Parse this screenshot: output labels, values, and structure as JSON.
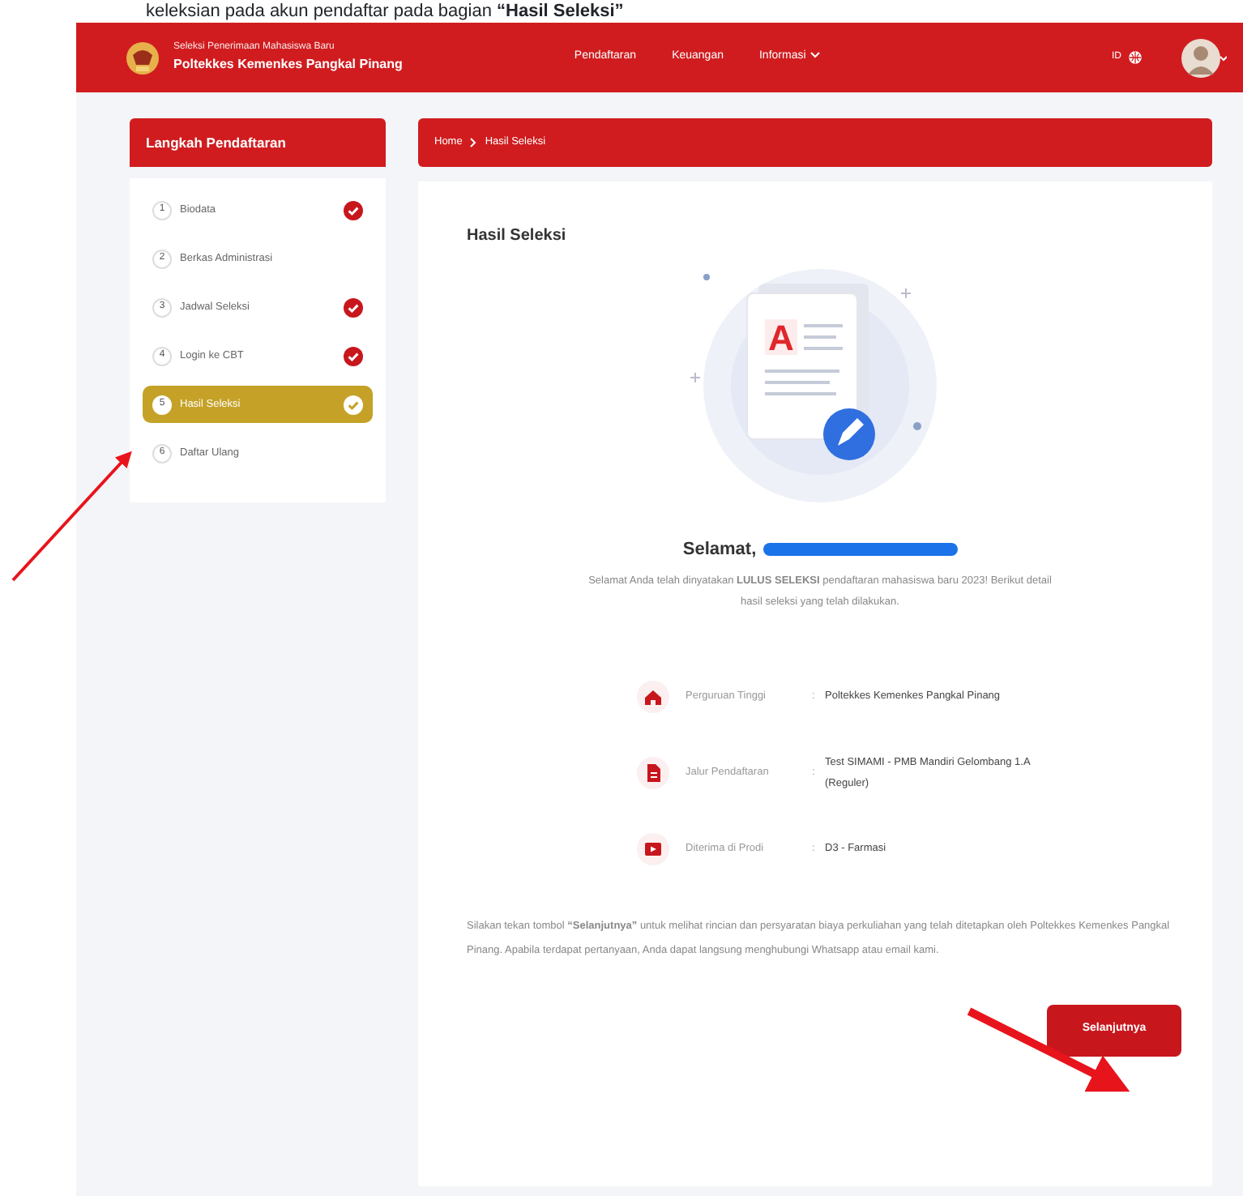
{
  "doc_text": "keleksian pada akun pendaftar pada bagian **“Hasil Seleksi”**",
  "navbar": {
    "subtitle": "Seleksi Penerimaan Mahasiswa Baru",
    "title": "Poltekkes Kemenkes Pangkal Pinang",
    "menu": [
      {
        "label": "Pendaftaran",
        "dropdown": false
      },
      {
        "label": "Keuangan",
        "dropdown": false
      },
      {
        "label": "Informasi",
        "dropdown": true
      }
    ],
    "language": "ID"
  },
  "sidebar": {
    "title": "Langkah Pendaftaran",
    "steps": [
      {
        "number": "1",
        "label": "Biodata",
        "done": true,
        "selected": false
      },
      {
        "number": "2",
        "label": "Berkas Administrasi",
        "done": false,
        "selected": false
      },
      {
        "number": "3",
        "label": "Jadwal Seleksi",
        "done": true,
        "selected": false
      },
      {
        "number": "4",
        "label": "Login ke CBT",
        "done": true,
        "selected": false
      },
      {
        "number": "5",
        "label": "Hasil Seleksi",
        "done": true,
        "selected": true
      },
      {
        "number": "6",
        "label": "Daftar Ulang",
        "done": false,
        "selected": false
      }
    ]
  },
  "breadcrumb": [
    "Home",
    "Hasil Seleksi"
  ],
  "result": {
    "title": "Hasil Seleksi",
    "illustration_letter": "A",
    "greeting": "Selamat,",
    "message": "Selamat Anda telah dinyatakan **LULUS SELEKSI** pendaftaran mahasiswa baru 2023! Berikut detail hasil seleksi yang telah dilakukan.",
    "details": [
      {
        "kind": "campus",
        "label": "Perguruan Tinggi",
        "separator": ":",
        "value": "Poltekkes Kemenkes Pangkal Pinang"
      },
      {
        "kind": "route",
        "label": "Jalur Pendaftaran",
        "separator": ":",
        "value": "Test SIMAMI - PMB Mandiri Gelombang 1.A (Reguler)"
      },
      {
        "kind": "program",
        "label": "Diterima di Prodi",
        "separator": ":",
        "value": "D3 - Farmasi"
      }
    ],
    "note": "Silakan tekan tombol **“Selanjutnya”** untuk melihat rincian dan persyaratan biaya perkuliahan yang telah ditetapkan oleh Poltekkes Kemenkes Pangkal Pinang. Apabila terdapat pertanyaan, Anda dapat langsung menghubungi Whatsapp atau email kami.",
    "button": "Selanjutnya"
  }
}
